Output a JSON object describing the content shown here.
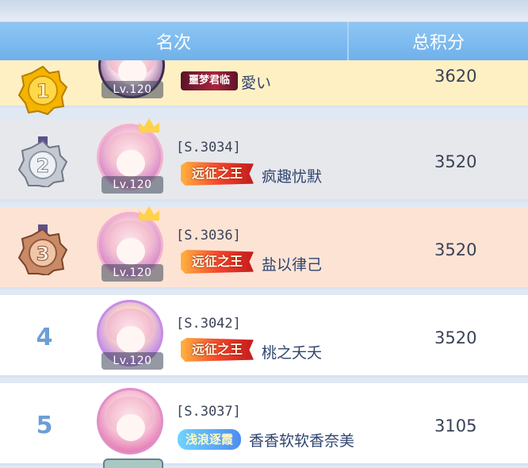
{
  "header": {
    "rank_label": "名次",
    "score_label": "总积分"
  },
  "rows": [
    {
      "rank": "1",
      "medal": "gold-medal-icon",
      "lv": "Lv.120",
      "server": "",
      "title": "噩梦君临",
      "name": "愛い",
      "score": "3620"
    },
    {
      "rank": "2",
      "medal": "silver-medal-icon",
      "lv": "Lv.120",
      "server": "[S.3034]",
      "title": "远征之王",
      "name": "疯趣忧默",
      "score": "3520"
    },
    {
      "rank": "3",
      "medal": "bronze-medal-icon",
      "lv": "Lv.120",
      "server": "[S.3036]",
      "title": "远征之王",
      "name": "盐以律己",
      "score": "3520"
    },
    {
      "rank": "4",
      "lv": "Lv.120",
      "server": "[S.3042]",
      "title": "远征之王",
      "name": "桃之夭夭",
      "score": "3520"
    },
    {
      "rank": "5",
      "lv": "",
      "server": "[S.3037]",
      "title": "浅浪逐霞",
      "name": "香香软软香奈美",
      "score": "3105"
    }
  ],
  "colors": {
    "header": "#7dbbf0",
    "gold_row": "#fff0c4",
    "silver_row": "#e7e8ec",
    "bronze_row": "#fde3d4",
    "rank_number": "#6d9ed4"
  }
}
